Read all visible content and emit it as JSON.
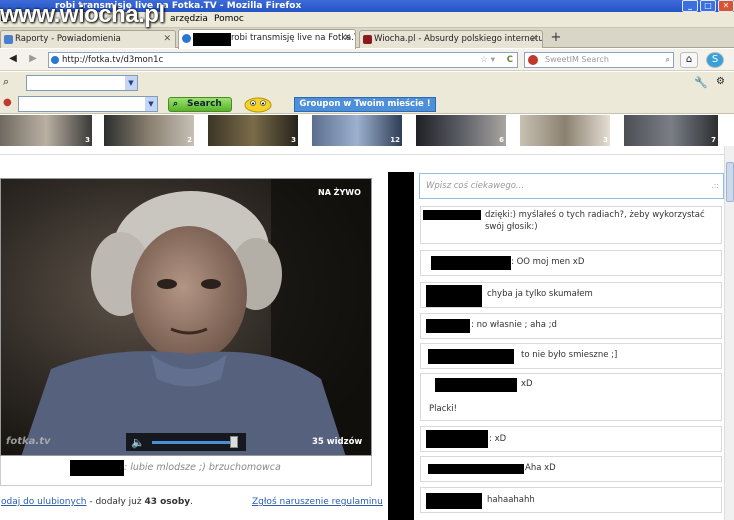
{
  "watermark": "www.wiocha.pl",
  "window": {
    "title": "robi transmisję live na Fotka.TV - Mozilla Firefox"
  },
  "menu": {
    "left_fragment": "Edi",
    "tools_fragment": "arzędzia",
    "help": "Pomoc"
  },
  "tabs": [
    {
      "label": "Raporty - Powiadomienia",
      "active": false
    },
    {
      "label": "robi transmisję live na Fotka.TV",
      "active": true
    },
    {
      "label": "Wiocha.pl - Absurdy polskiego internetu: ...",
      "active": false
    }
  ],
  "url": "http://fotka.tv/d3mon1c",
  "search": {
    "placeholder": "SweetIM Search"
  },
  "toolbar": {
    "search_label": "Search",
    "groupon_label": "Groupon w Twoim mieście !"
  },
  "thumbnails": [
    {
      "count": "3"
    },
    {
      "count": "2"
    },
    {
      "count": "3"
    },
    {
      "count": "12"
    },
    {
      "count": "6"
    },
    {
      "count": "3"
    },
    {
      "count": "7"
    }
  ],
  "video": {
    "live_label": "NA ŻYWO",
    "brand": "fotka.tv",
    "viewers": "35 widzów"
  },
  "caption": ": lubie mlodsze ;) brzuchomowca",
  "favorites": {
    "link": "odaj do ulubionych",
    "text": " - dodały już ",
    "count": "43 osoby",
    "dot": "."
  },
  "report_link": "Zgłoś naruszenie regulaminu",
  "subline": "",
  "chat": {
    "placeholder": "Wpisz coś ciekawego...",
    "messages": [
      {
        "text": "dzięki:) myślałeś o tych radiach?, żeby wykorzystać swój głosik:)"
      },
      {
        "text": ": OO moj men xD"
      },
      {
        "text": "chyba ja tylko skumałem"
      },
      {
        "text": ": no własnie ; aha ;d"
      },
      {
        "text": "to nie było smieszne ;]"
      },
      {
        "text": "xD",
        "extra": "Placki!"
      },
      {
        "text": ": xD"
      },
      {
        "text": "Aha xD"
      },
      {
        "text": "hahaahahh"
      }
    ]
  }
}
